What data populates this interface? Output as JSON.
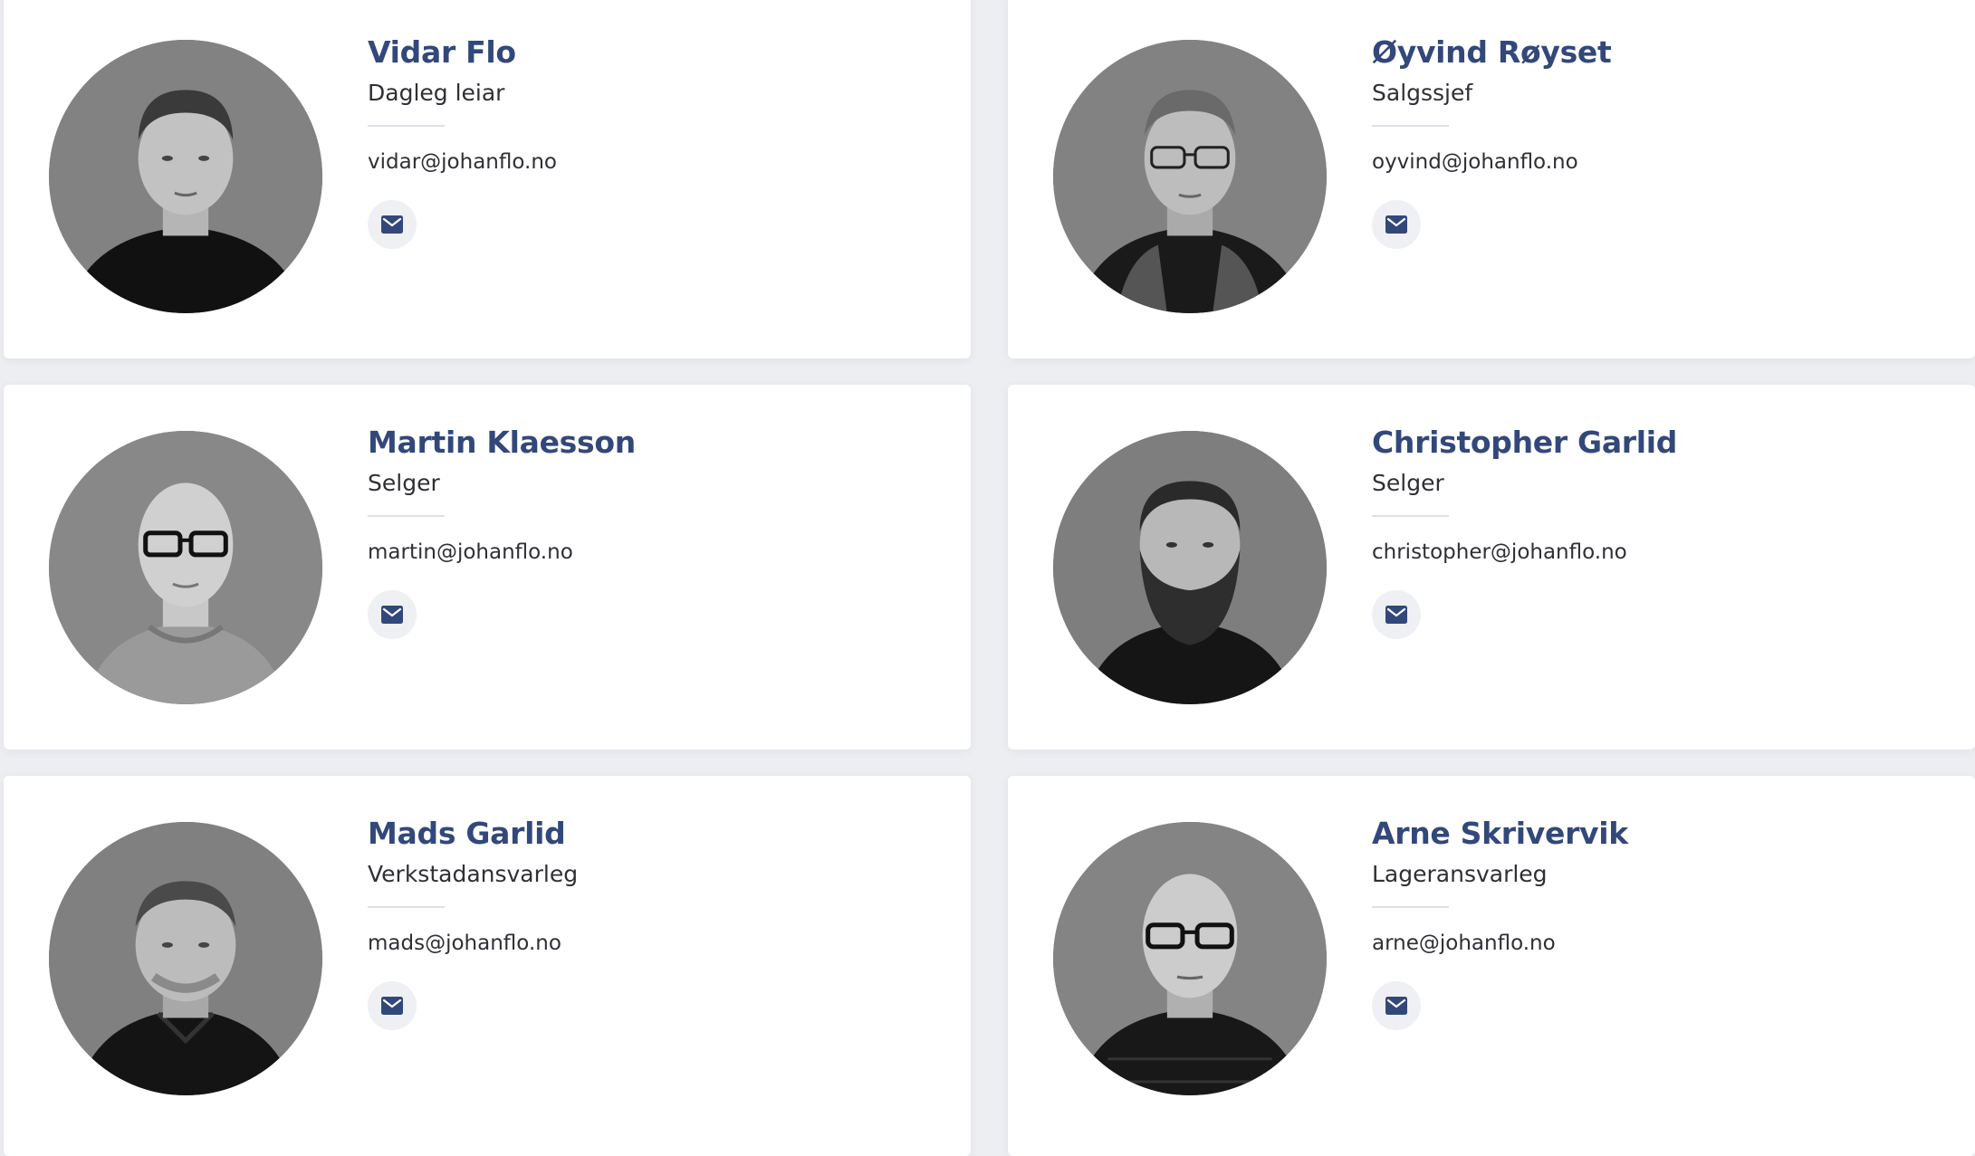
{
  "colors": {
    "page_background": "#eceef2",
    "card_background": "#ffffff",
    "name_color": "#33487a",
    "text_color": "#2f2f35",
    "icon_background": "#eef0f4",
    "icon_color": "#33487a"
  },
  "icons": {
    "mail": "envelope-icon"
  },
  "employees": [
    {
      "name": "Vidar Flo",
      "role": "Dagleg leiar",
      "email": "vidar@johanflo.no",
      "photo": "portrait-photo"
    },
    {
      "name": "Øyvind Røyset",
      "role": "Salgssjef",
      "email": "oyvind@johanflo.no",
      "photo": "portrait-photo"
    },
    {
      "name": "Martin Klaesson",
      "role": "Selger",
      "email": "martin@johanflo.no",
      "photo": "portrait-photo"
    },
    {
      "name": "Christopher Garlid",
      "role": "Selger",
      "email": "christopher@johanflo.no",
      "photo": "portrait-photo"
    },
    {
      "name": "Mads Garlid",
      "role": "Verkstadansvarleg",
      "email": "mads@johanflo.no",
      "photo": "portrait-photo"
    },
    {
      "name": "Arne Skrivervik",
      "role": "Lageransvarleg",
      "email": "arne@johanflo.no",
      "photo": "portrait-photo"
    }
  ]
}
